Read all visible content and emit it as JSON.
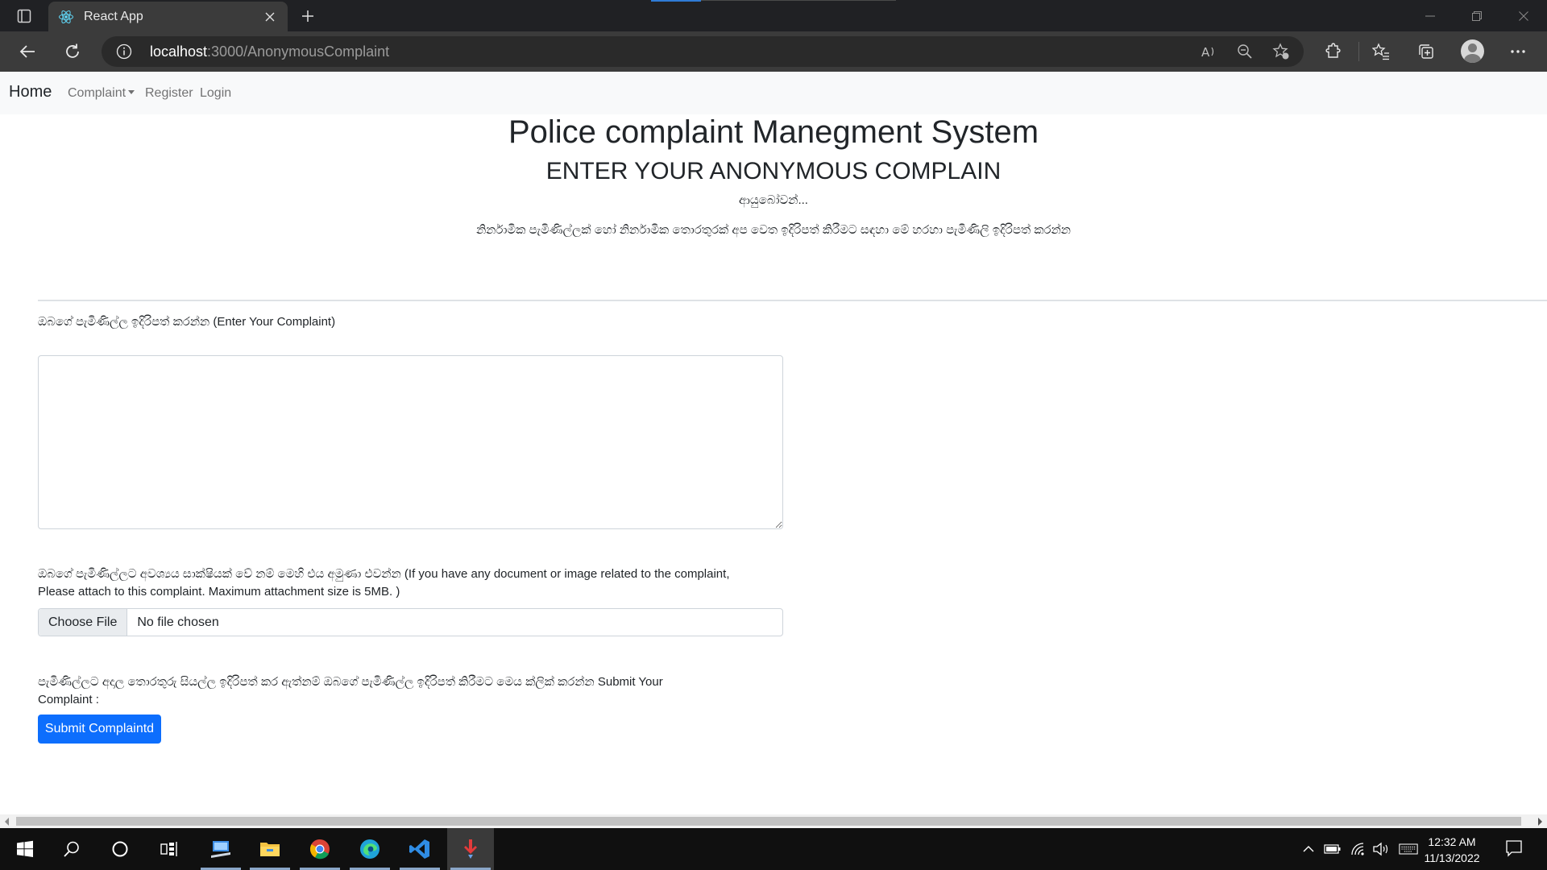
{
  "browser": {
    "tab_title": "React App",
    "url_host": "localhost",
    "url_rest": ":3000/AnonymousComplaint"
  },
  "navbar": {
    "brand": "Home",
    "links": [
      "Complaint",
      "Register",
      "Login"
    ]
  },
  "page": {
    "title": "Police complaint Manegment System",
    "subtitle": "ENTER YOUR ANONYMOUS COMPLAIN",
    "greeting": "ආයුබෝවන්...",
    "intro": "නිර්නාමික පැමිණිල්ලක් හෝ නිර්නාමික තොරතුරක් අප වෙත ඉදිරිපත් කිරීමට සඳහා මේ හරහා පැමිණිලි ඉදිරිපත් කරන්න",
    "complaint_label": "ඔබගේ පැමිණිල්ල ඉදිරිපත් කරන්න (Enter Your Complaint)",
    "complaint_value": "",
    "attachment_label_line1": "ඔබගේ පැමිණිල්ලට අවශ්‍යය සාක්ෂියක් වේ නම් මෙහි එය අමුණා එවන්න (If you have any document or image related to the complaint,",
    "attachment_label_line2": "Please attach to this complaint. Maximum attachment size is 5MB. )",
    "file_button": "Choose File",
    "file_status": "No file chosen",
    "submit_label_line1": "පැමිණිල්ලට අදාල තොරතුරු සියල්ල ඉදිරිපත් කර ඇත්නම් ඔබගේ පැමිණිල්ල ඉදිරිපත් කිරීමට මෙය ක්ලික් කරන්න Submit Your",
    "submit_label_line2": "Complaint :",
    "submit_button": "Submit Complaintd"
  },
  "taskbar": {
    "time": "12:32 AM",
    "date": "11/13/2022"
  },
  "icons": {
    "tab_favicon": "react-icon",
    "taskbar_apps": [
      "windows-start-icon",
      "search-icon",
      "cortana-icon",
      "task-view-icon",
      "remote-desktop-icon",
      "file-explorer-icon",
      "chrome-icon",
      "edge-icon",
      "vscode-icon",
      "app-icon"
    ]
  },
  "colors": {
    "primary": "#0d6efd",
    "navbar_bg": "#f8f9fa",
    "chrome_dark": "#202124",
    "toolbar": "#3b3b3b"
  }
}
